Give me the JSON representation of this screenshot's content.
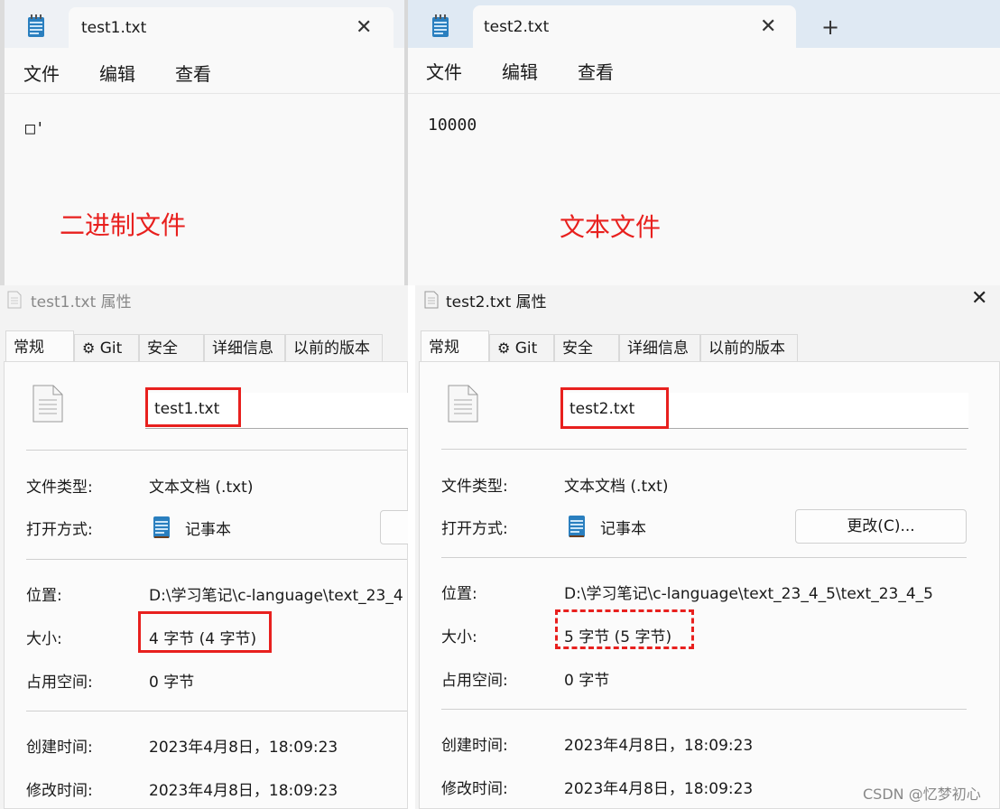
{
  "notepad_left": {
    "tab_title": "test1.txt",
    "menu": [
      "文件",
      "编辑",
      "查看"
    ],
    "content": "□'",
    "annotation": "二进制文件"
  },
  "notepad_right": {
    "tab_title": "test2.txt",
    "new_tab": "+",
    "menu": [
      "文件",
      "编辑",
      "查看"
    ],
    "content": "10000",
    "annotation": "文本文件"
  },
  "dialog_left": {
    "title": "test1.txt 属性",
    "tabs": [
      "常规",
      "Git",
      "安全",
      "详细信息",
      "以前的版本"
    ],
    "filename": "test1.txt",
    "rows": {
      "type_label": "文件类型:",
      "type_value": "文本文档 (.txt)",
      "open_label": "打开方式:",
      "open_value": "记事本",
      "location_label": "位置:",
      "location_value": "D:\\学习笔记\\c-language\\text_23_4",
      "size_label": "大小:",
      "size_value": "4 字节 (4 字节)",
      "disk_label": "占用空间:",
      "disk_value": "0 字节",
      "created_label": "创建时间:",
      "created_value": "2023年4月8日，18:09:23",
      "modified_label": "修改时间:",
      "modified_value": "2023年4月8日，18:09:23"
    }
  },
  "dialog_right": {
    "title": "test2.txt 属性",
    "close": "✕",
    "tabs": [
      "常规",
      "Git",
      "安全",
      "详细信息",
      "以前的版本"
    ],
    "filename": "test2.txt",
    "rows": {
      "type_label": "文件类型:",
      "type_value": "文本文档 (.txt)",
      "open_label": "打开方式:",
      "open_value": "记事本",
      "change_button": "更改(C)...",
      "location_label": "位置:",
      "location_value": "D:\\学习笔记\\c-language\\text_23_4_5\\text_23_4_5",
      "size_label": "大小:",
      "size_value": "5 字节 (5 字节)",
      "disk_label": "占用空间:",
      "disk_value": "0 字节",
      "created_label": "创建时间:",
      "created_value": "2023年4月8日，18:09:23",
      "modified_label": "修改时间:",
      "modified_value": "2023年4月8日，18:09:23"
    }
  },
  "watermark": "CSDN @忆梦初心",
  "colors": {
    "annotation_red": "#e8201e",
    "notepad_icon": "#2a7fbf"
  }
}
